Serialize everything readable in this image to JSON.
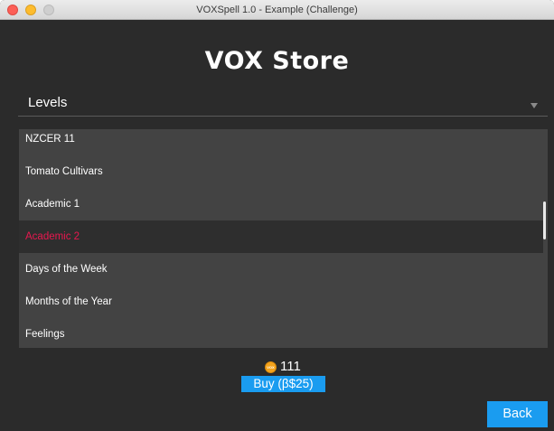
{
  "window": {
    "title": "VOXSpell 1.0 - Example (Challenge)"
  },
  "store": {
    "title": "VOX Store"
  },
  "dropdown": {
    "selected": "Levels"
  },
  "levels": {
    "items": [
      "NZCER 11",
      "Tomato Cultivars",
      "Academic 1",
      "Academic 2",
      "Days of the Week",
      "Months of the Year",
      "Feelings"
    ],
    "selected_index": 3
  },
  "coins": {
    "icon_text": "VOX",
    "count": "111"
  },
  "buttons": {
    "buy": "Buy (β$25)",
    "back": "Back"
  },
  "colors": {
    "background": "#2b2b2b",
    "list_background": "#434343",
    "selected_row": "#2e2e2e",
    "selected_text": "#e8174f",
    "accent_button": "#1a9cf0",
    "coin": "#f4a31c"
  }
}
